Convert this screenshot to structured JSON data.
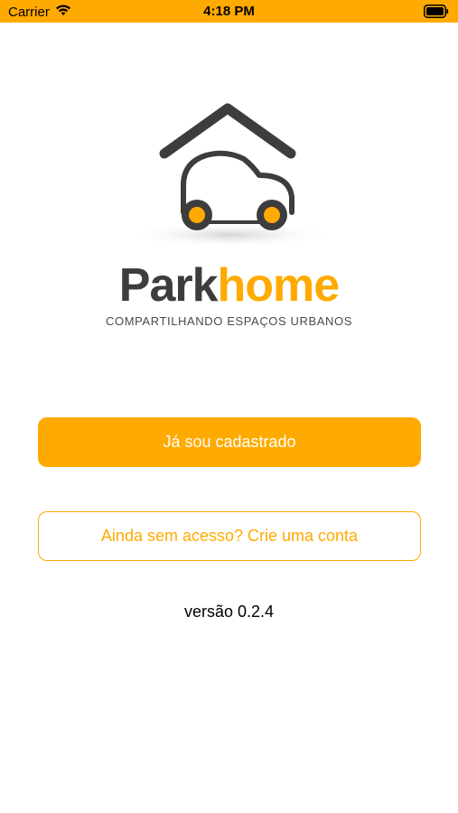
{
  "status_bar": {
    "carrier": "Carrier",
    "time": "4:18 PM",
    "background_color": "#FFAA00",
    "wifi_icon": "wifi-icon",
    "battery_icon": "battery-icon"
  },
  "logo": {
    "icon": "house-car-icon",
    "brand_part1": "Park",
    "brand_part2": "home",
    "tagline": "COMPARTILHANDO ESPAÇOS URBANOS",
    "brand_dark_color": "#3d3d3d",
    "brand_accent_color": "#FFAA00"
  },
  "actions": {
    "login_label": "Já sou cadastrado",
    "signup_label": "Ainda sem acesso? Crie uma conta"
  },
  "footer": {
    "version": "versão 0.2.4"
  }
}
